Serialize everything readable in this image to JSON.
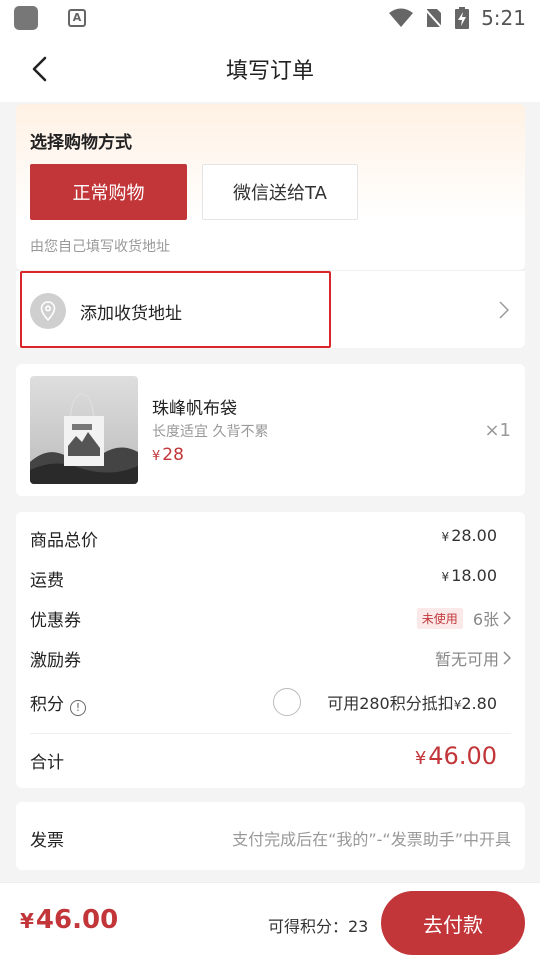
{
  "status_bar": {
    "time": "5:21"
  },
  "header": {
    "title": "填写订单"
  },
  "shopping_mode": {
    "title": "选择购物方式",
    "options": [
      "正常购物",
      "微信送给TA"
    ],
    "selected": "正常购物",
    "hint": "由您自己填写收货地址"
  },
  "address": {
    "label": "添加收货地址"
  },
  "product": {
    "name": "珠峰帆布袋",
    "description": "长度适宜 久背不累",
    "currency": "¥",
    "price": "28",
    "quantity": "×1"
  },
  "summary": {
    "currency": "¥",
    "goods_total": {
      "label": "商品总价",
      "value": "28.00"
    },
    "shipping": {
      "label": "运费",
      "value": "18.00"
    },
    "coupon": {
      "label": "优惠券",
      "badge": "未使用",
      "value": "6张"
    },
    "incentive": {
      "label": "激励券",
      "value": "暂无可用"
    },
    "points": {
      "label": "积分",
      "info_icon": "!",
      "text": "可用280积分抵扣",
      "value": "2.80"
    },
    "total": {
      "label": "合计",
      "value": "46.00"
    }
  },
  "invoice": {
    "label": "发票",
    "note": "支付完成后在“我的”-“发票助手”中开具"
  },
  "footer": {
    "currency": "¥",
    "total": "46.00",
    "earn_points": "可得积分：23",
    "pay_label": "去付款"
  },
  "colors": {
    "accent": "#c2363a",
    "highlight_border": "#d8262b"
  }
}
